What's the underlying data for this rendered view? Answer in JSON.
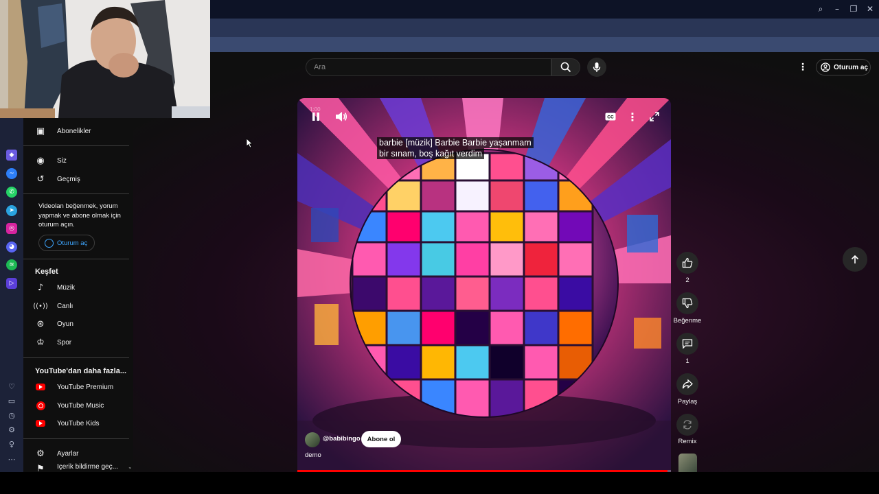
{
  "search": {
    "placeholder": "Ara"
  },
  "header": {
    "signin_label": "Oturum aç"
  },
  "sidebar": {
    "subscriptions": "Abonelikler",
    "you": "Siz",
    "history": "Geçmiş",
    "signin_prompt": "Videolan beğenmek, yorum yapmak ve abone olmak için oturum açın.",
    "signin_button": "Oturum aç",
    "explore_title": "Keşfet",
    "explore": [
      {
        "label": "Müzik",
        "icon": "music-note-icon"
      },
      {
        "label": "Canlı",
        "icon": "live-icon"
      },
      {
        "label": "Oyun",
        "icon": "gaming-icon"
      },
      {
        "label": "Spor",
        "icon": "trophy-icon"
      }
    ],
    "more_title": "YouTube'dan daha fazla...",
    "more": [
      {
        "label": "YouTube Premium"
      },
      {
        "label": "YouTube Music"
      },
      {
        "label": "YouTube Kids"
      }
    ],
    "settings": "Ayarlar",
    "report_history": "İçerik bildirme geç..."
  },
  "player": {
    "time": "1:00",
    "captions": [
      "barbie [müzik] Barbie Barbie yaşanmam",
      "bir sınam, boş kağıt verdim"
    ],
    "channel": "@babibingo",
    "subscribe": "Abone ol",
    "title": "demo",
    "progress_fraction": 0.99
  },
  "actions": {
    "like_count": "2",
    "dislike": "Beğenme",
    "comment_count": "1",
    "share": "Paylaş",
    "remix": "Remix"
  },
  "colors": {
    "accent_red": "#ff0000",
    "page_bg": "#0f0f0f",
    "chip_bg": "#272727"
  }
}
